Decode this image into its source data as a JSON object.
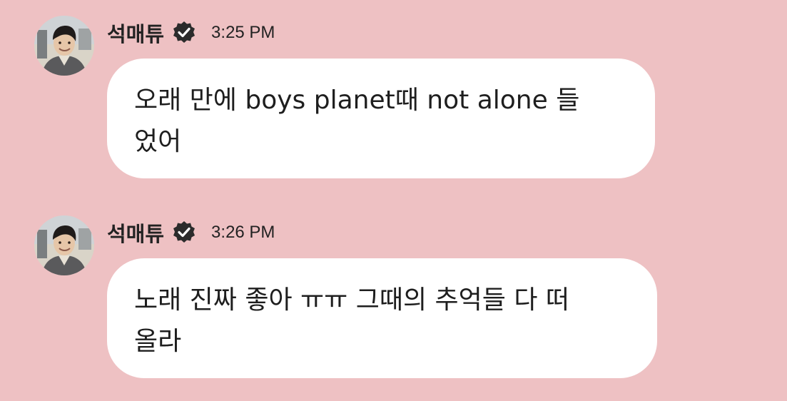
{
  "messages": [
    {
      "sender": "석매튜",
      "time": "3:25 PM",
      "text": "오래 만에 boys planet때 not alone 들\n었어"
    },
    {
      "sender": "석매튜",
      "time": "3:26 PM",
      "text": "노래 진짜 좋아 ㅠㅠ 그때의 추억들 다 떠\n올라"
    }
  ],
  "icons": {
    "verified": "verified-badge-icon",
    "avatar": "profile-avatar"
  },
  "colors": {
    "background": "#eec1c3",
    "bubble": "#ffffff",
    "text": "#1e1e1e",
    "badge": "#2b2b2b"
  }
}
